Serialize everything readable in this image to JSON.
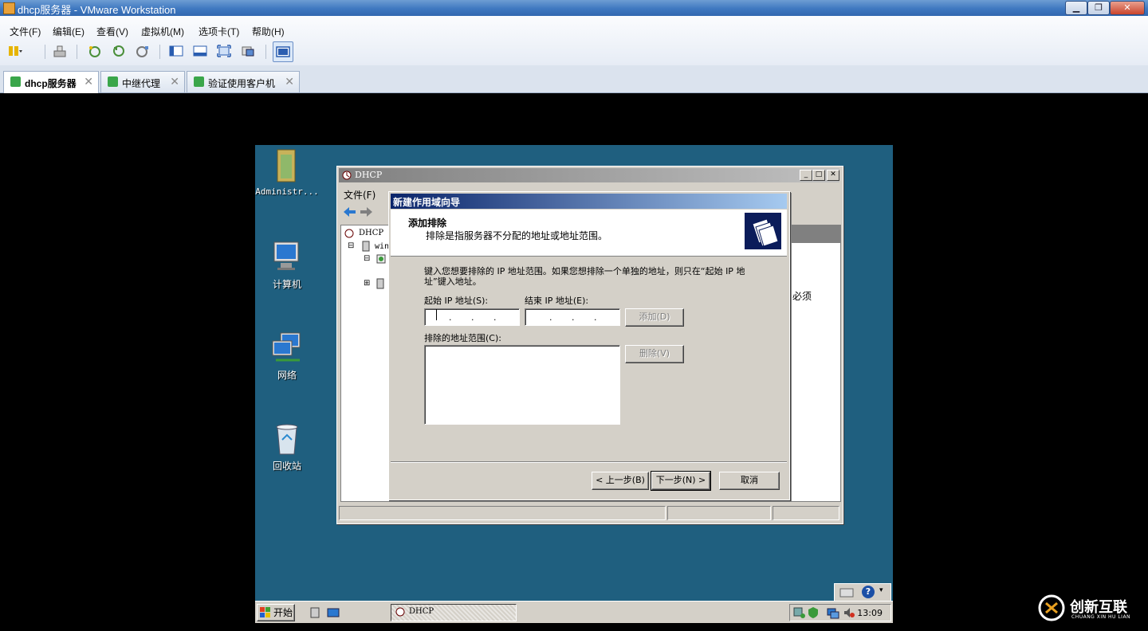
{
  "vmware": {
    "window_title": "dhcp服务器 - VMware Workstation",
    "menu": [
      "文件(F)",
      "编辑(E)",
      "查看(V)",
      "虚拟机(M)",
      "选项卡(T)",
      "帮助(H)"
    ],
    "tabs": [
      {
        "label": "dhcp服务器",
        "active": true
      },
      {
        "label": "中继代理",
        "active": false
      },
      {
        "label": "验证使用客户机",
        "active": false
      }
    ]
  },
  "guest": {
    "desktop_icons": [
      {
        "label": "Administr...",
        "icon": "folder-icon"
      },
      {
        "label": "计算机",
        "icon": "computer-icon"
      },
      {
        "label": "网络",
        "icon": "network-icon"
      },
      {
        "label": "回收站",
        "icon": "recycle-bin-icon"
      }
    ],
    "mmc": {
      "title": "DHCP",
      "menu_first": "文件(F)",
      "tree_root": "DHCP",
      "tree_child": "win",
      "right_partial_text": "必须"
    },
    "wizard": {
      "title": "新建作用域向导",
      "header_title": "添加排除",
      "header_subtitle": "排除是指服务器不分配的地址或地址范围。",
      "description": "键入您想要排除的 IP 地址范围。如果您想排除一个单独的地址，则只在“起始 IP 地址”键入地址。",
      "start_ip_label": "起始 IP 地址(S):",
      "end_ip_label": "结束 IP 地址(E):",
      "add_button": "添加(D)",
      "excluded_label": "排除的地址范围(C):",
      "remove_button": "删除(V)",
      "back_button": "< 上一步(B)",
      "next_button": "下一步(N) >",
      "cancel_button": "取消"
    },
    "taskbar": {
      "start_label": "开始",
      "task_label": "DHCP",
      "clock": "13:09"
    }
  },
  "watermark": {
    "text": "创新互联",
    "subtext": "CHUANG XIN HU LIAN"
  },
  "colors": {
    "desktop": "#1f5f7f",
    "wizard_caption": "#0a246a",
    "vmware_title": "#3f78c0"
  }
}
